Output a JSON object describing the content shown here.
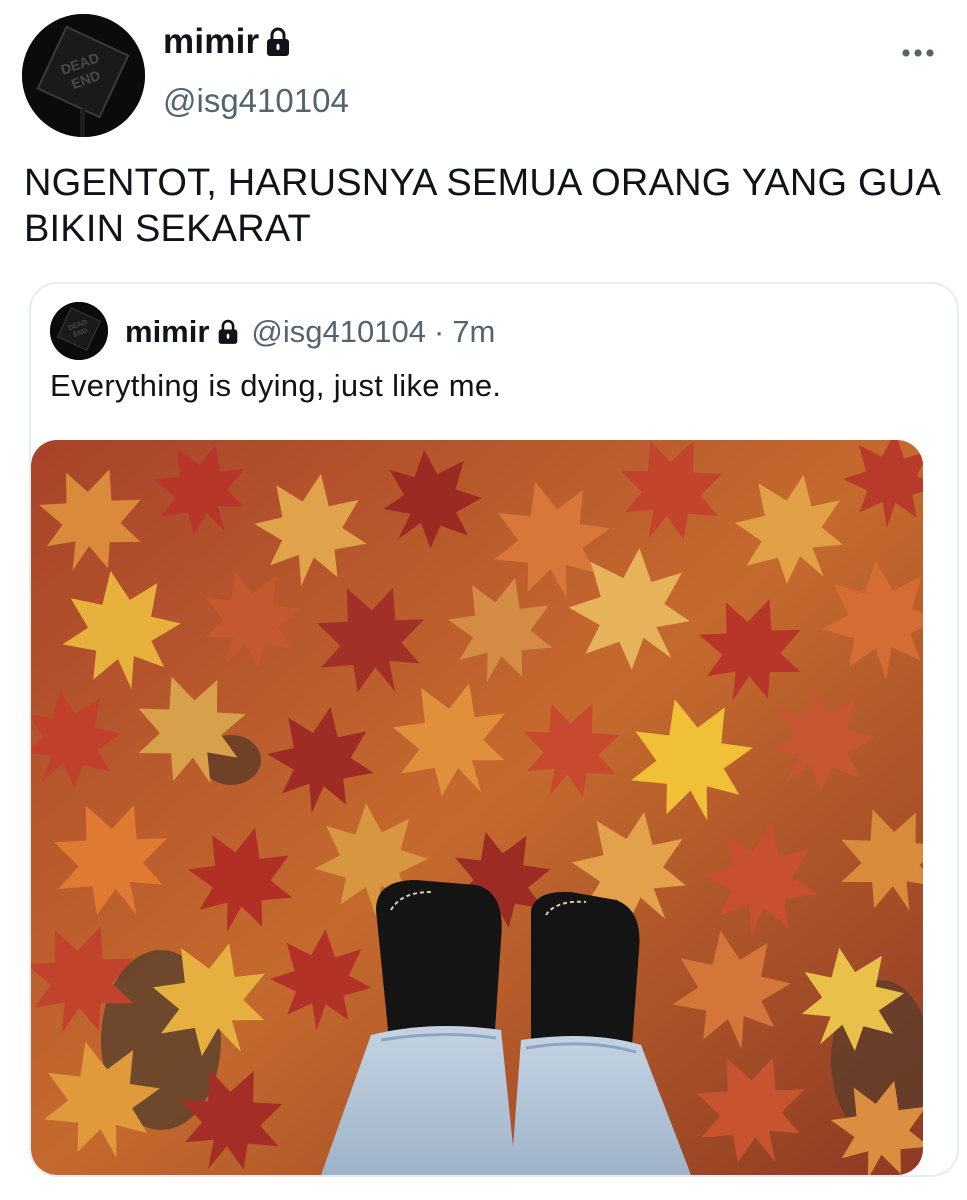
{
  "author": {
    "name": "mimir",
    "handle": "@isg410104",
    "avatar_text": [
      "DEAD",
      "END"
    ],
    "protected_icon": "lock-icon"
  },
  "menu_icon": "more-dots-icon",
  "tweet": {
    "text": "NGENTOT, HARUSNYA SEMUA ORANG YANG GUA BIKIN SEKARAT"
  },
  "quoted_tweet": {
    "name": "mimir",
    "handle": "@isg410104",
    "separator": "·",
    "time": "7m",
    "text": "Everything is dying, just like me.",
    "media_icon": "autumn-leaves-photo"
  },
  "colors": {
    "text": "#0f1419",
    "secondary": "#536471",
    "border": "#e6ecf0"
  }
}
